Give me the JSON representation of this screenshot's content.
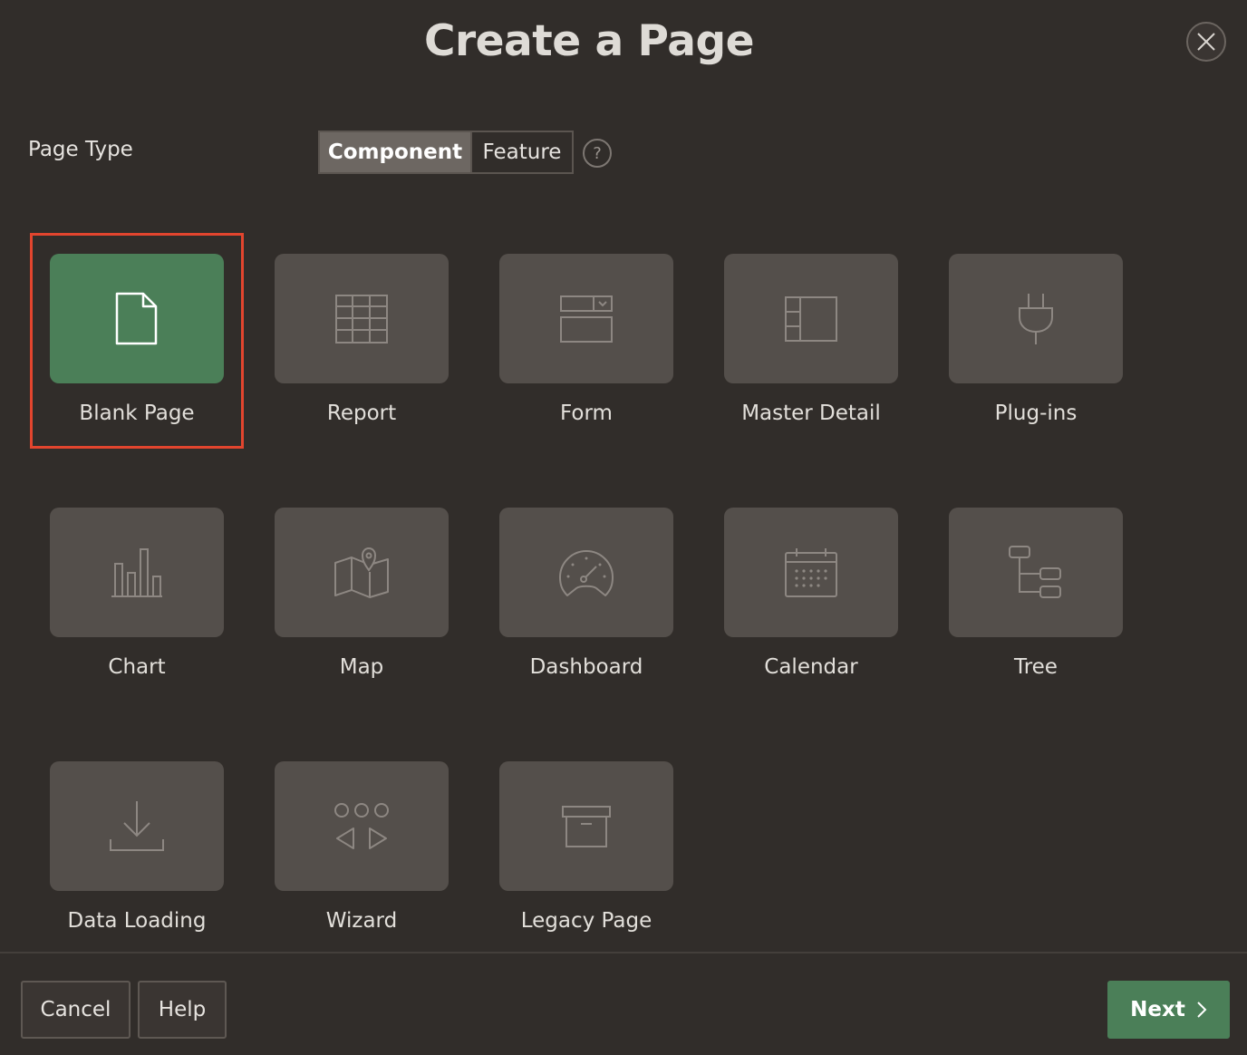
{
  "dialog": {
    "title": "Create a Page",
    "close_icon": "close-icon"
  },
  "page_type": {
    "label": "Page Type",
    "options": [
      "Component",
      "Feature"
    ],
    "selected": "Component",
    "help_glyph": "?"
  },
  "tiles": [
    {
      "label": "Blank Page",
      "icon": "blank-page-icon",
      "selected": true
    },
    {
      "label": "Report",
      "icon": "report-grid-icon",
      "selected": false
    },
    {
      "label": "Form",
      "icon": "form-icon",
      "selected": false
    },
    {
      "label": "Master Detail",
      "icon": "master-detail-icon",
      "selected": false
    },
    {
      "label": "Plug-ins",
      "icon": "plug-icon",
      "selected": false
    },
    {
      "label": "Chart",
      "icon": "bar-chart-icon",
      "selected": false
    },
    {
      "label": "Map",
      "icon": "map-icon",
      "selected": false
    },
    {
      "label": "Dashboard",
      "icon": "gauge-icon",
      "selected": false
    },
    {
      "label": "Calendar",
      "icon": "calendar-icon",
      "selected": false
    },
    {
      "label": "Tree",
      "icon": "tree-icon",
      "selected": false
    },
    {
      "label": "Data Loading",
      "icon": "download-icon",
      "selected": false
    },
    {
      "label": "Wizard",
      "icon": "wizard-icon",
      "selected": false
    },
    {
      "label": "Legacy Page",
      "icon": "archive-box-icon",
      "selected": false
    }
  ],
  "footer": {
    "cancel_label": "Cancel",
    "help_label": "Help",
    "next_label": "Next"
  },
  "colors": {
    "background": "#312d2a",
    "tile": "#544f4b",
    "selected_tile": "#4b7f58",
    "selection_outline": "#e2452e",
    "next_button": "#4b7f58"
  }
}
